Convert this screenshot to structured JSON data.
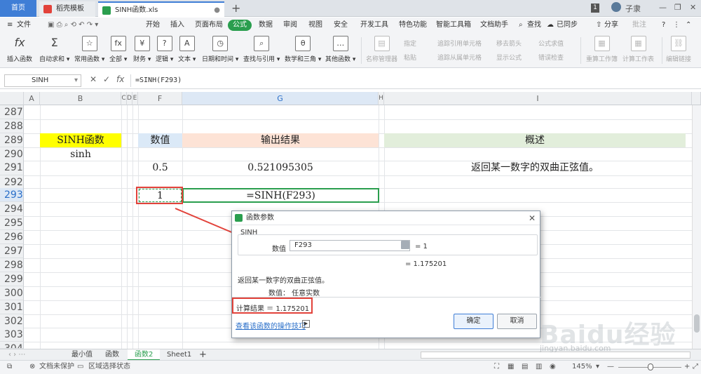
{
  "tabs": {
    "home": "首页",
    "template": "稻壳模板",
    "file": "SINH函数.xls",
    "add": "+"
  },
  "window": {
    "badge": "1",
    "user": "子隶"
  },
  "menu": {
    "file": "文件",
    "items": [
      "开始",
      "插入",
      "页面布局",
      "公式",
      "数据",
      "审阅",
      "视图",
      "安全",
      "开发工具",
      "特色功能",
      "智能工具箱",
      "文档助手"
    ],
    "search": "查找",
    "sync": "已同步",
    "share": "分享",
    "comment": "批注"
  },
  "ribbon": {
    "buttons": [
      "插入函数",
      "自动求和",
      "常用函数",
      "全部",
      "财务",
      "逻辑",
      "文本",
      "日期和时间",
      "查找与引用",
      "数学和三角",
      "其他函数"
    ],
    "dim_buttons": [
      "名称管理器",
      "重算工作簿",
      "计算工作表",
      "编辑链接"
    ],
    "small": [
      "指定",
      "粘贴",
      "追踪引用单元格",
      "追踪从属单元格",
      "移去箭头",
      "显示公式",
      "公式求值",
      "错误检查"
    ]
  },
  "formula_bar": {
    "cell_name": "SINH",
    "cancel": "✕",
    "confirm": "✓",
    "fx": "fx",
    "formula": "=SINH(F293)"
  },
  "columns": [
    "A",
    "B",
    "C",
    "D",
    "E",
    "F",
    "G",
    "H",
    "I"
  ],
  "rows": [
    "287",
    "288",
    "289",
    "290",
    "291",
    "292",
    "293",
    "294",
    "295",
    "296",
    "297",
    "298",
    "299",
    "300",
    "301",
    "302",
    "303",
    "304"
  ],
  "cells": {
    "b289": "SINH函数",
    "b290": "sinh",
    "f289": "数值",
    "g289": "输出结果",
    "i289": "概述",
    "f291": "0.5",
    "g291": "0.521095305",
    "i291": "返回某一数字的双曲正弦值。",
    "f293": "1",
    "g293": "=SINH(F293)"
  },
  "sheets": [
    "最小值",
    "函数",
    "函数2",
    "Sheet1",
    "+"
  ],
  "status": {
    "protect": "文档未保护",
    "region": "区域选择状态",
    "zoom": "145%"
  },
  "dialog": {
    "title": "函数参数",
    "function": "SINH",
    "arg_label": "数值",
    "arg_value": "F293",
    "arg_result": "= 1",
    "result": "= 1.175201",
    "description": "返回某一数字的双曲正弦值。",
    "arg_desc": "数值：  任意实数",
    "calc_result": "计算结果 ＝ 1.175201",
    "link": "查看该函数的操作技巧",
    "ok": "确定",
    "cancel": "取消",
    "close": "✕"
  },
  "watermark": {
    "main": "Baidu经验",
    "sub": "jingyan.baidu.com"
  },
  "colors": {
    "accent": "#2a9e4e",
    "yellow": "#ffff00",
    "blue_header": "#dbe9f7",
    "pink_header": "#fde3d6",
    "green_header": "#e2eedb",
    "red": "#e2423a"
  }
}
